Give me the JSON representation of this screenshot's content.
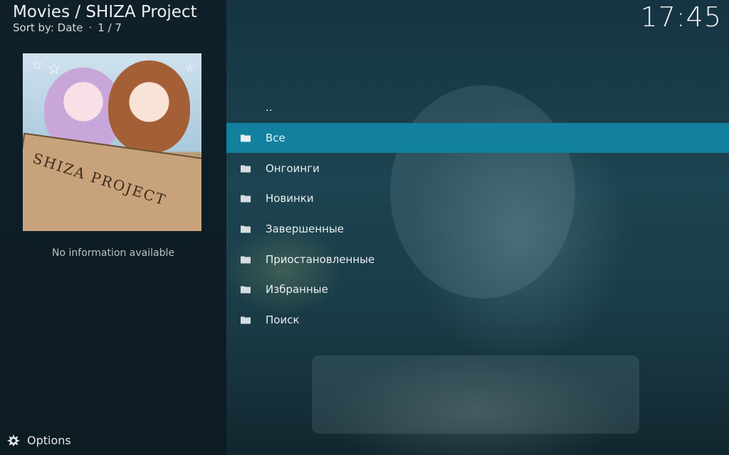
{
  "header": {
    "title": "Movies / SHIZA Project",
    "sort_label": "Sort by: Date",
    "separator": "·",
    "position": "1 / 7",
    "clock": "17:45"
  },
  "poster": {
    "text": "SHIZA PROJECT"
  },
  "info": {
    "no_info": "No information available"
  },
  "list": {
    "parent": "..",
    "items": [
      {
        "label": "Все",
        "icon": "folder-icon",
        "selected": true
      },
      {
        "label": "Онгоинги",
        "icon": "folder-icon",
        "selected": false
      },
      {
        "label": "Новинки",
        "icon": "folder-icon",
        "selected": false
      },
      {
        "label": "Завершенные",
        "icon": "folder-icon",
        "selected": false
      },
      {
        "label": "Приостановленные",
        "icon": "folder-icon",
        "selected": false
      },
      {
        "label": "Избранные",
        "icon": "folder-icon",
        "selected": false
      },
      {
        "label": "Поиск",
        "icon": "folder-icon",
        "selected": false
      }
    ]
  },
  "footer": {
    "options_label": "Options",
    "options_icon": "options-gear-icon"
  },
  "colors": {
    "accent": "#12809f",
    "panel": "#0d1b22"
  }
}
